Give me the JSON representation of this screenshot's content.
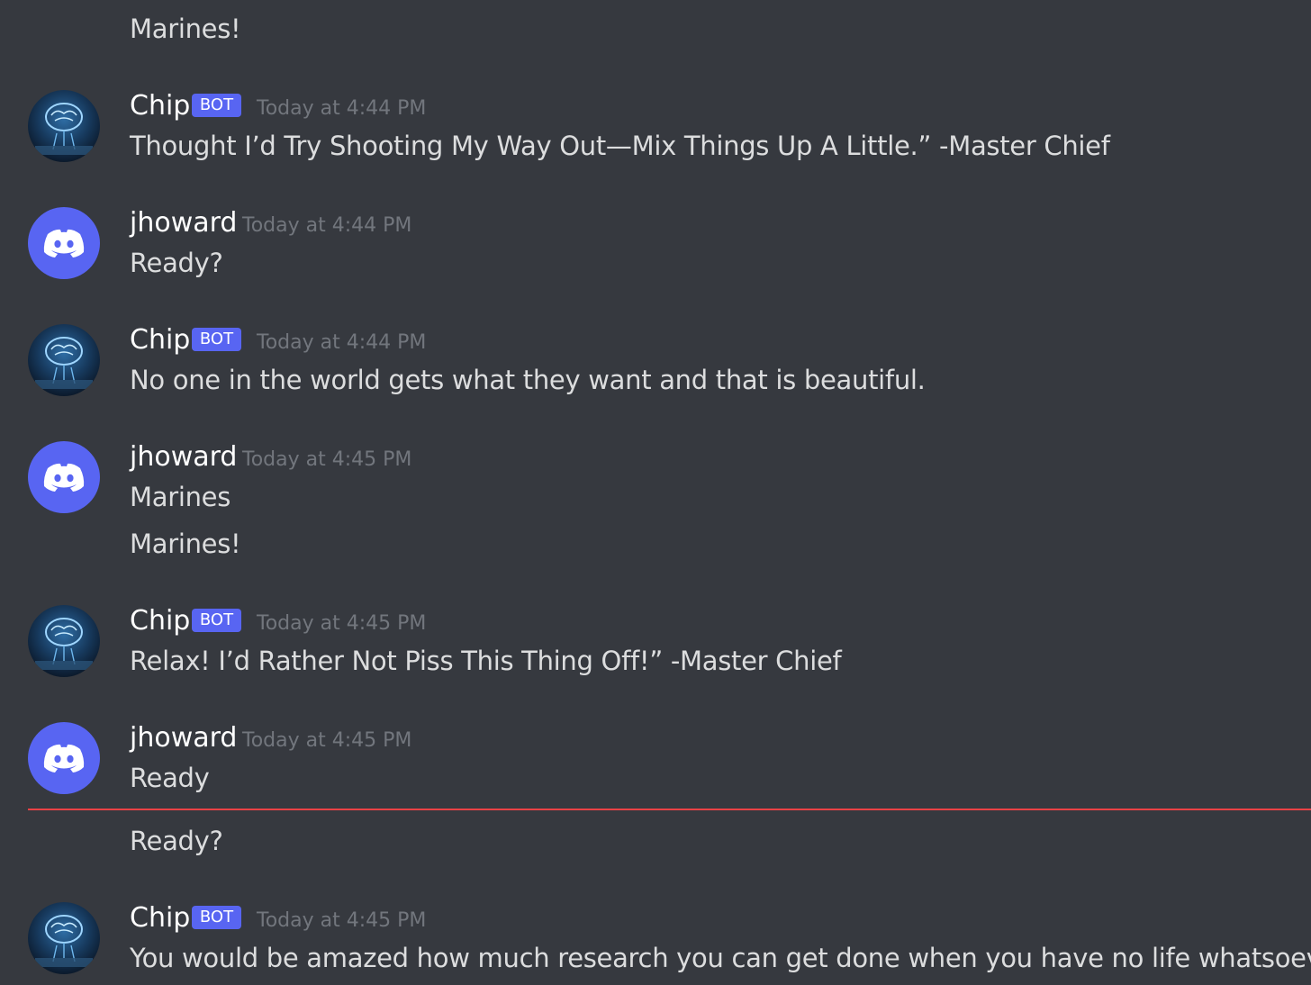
{
  "messages": [
    {
      "type": "continuation",
      "text": "Marines!"
    },
    {
      "type": "bot",
      "author": "Chip",
      "tag": "BOT",
      "timestamp": "Today at 4:44 PM",
      "text": "Thought I’d Try Shooting My Way Out—Mix Things Up A Little.” -Master Chief"
    },
    {
      "type": "user",
      "author": "jhoward",
      "timestamp": "Today at 4:44 PM",
      "text": "Ready?"
    },
    {
      "type": "bot",
      "author": "Chip",
      "tag": "BOT",
      "timestamp": "Today at 4:44 PM",
      "text": "No one in the world gets what they want and that is beautiful."
    },
    {
      "type": "user",
      "author": "jhoward",
      "timestamp": "Today at 4:45 PM",
      "text": "Marines",
      "continuation": "Marines!"
    },
    {
      "type": "bot",
      "author": "Chip",
      "tag": "BOT",
      "timestamp": "Today at 4:45 PM",
      "text": "Relax! I’d Rather Not Piss This Thing Off!” -Master Chief"
    },
    {
      "type": "user",
      "author": "jhoward",
      "timestamp": "Today at 4:45 PM",
      "text": "Ready",
      "continuation": "Ready?"
    },
    {
      "type": "bot",
      "author": "Chip",
      "tag": "BOT",
      "timestamp": "Today at 4:45 PM",
      "text": "You would be amazed how much research you can get done when you have no life whatsoever."
    }
  ],
  "colors": {
    "background": "#36393f",
    "blurple": "#5865f2",
    "new_divider": "#ed4245",
    "timestamp": "#72767d",
    "text": "#dcddde"
  }
}
